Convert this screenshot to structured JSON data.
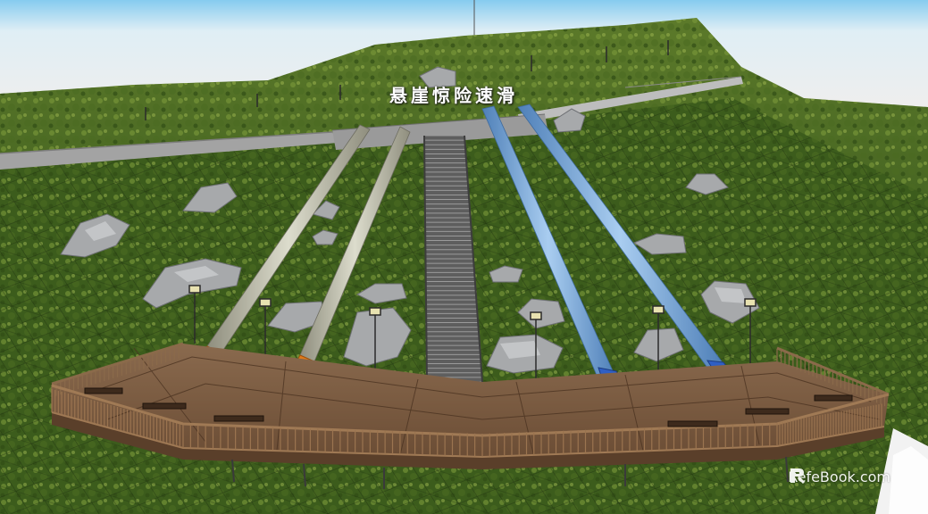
{
  "scene": {
    "sign_text": "悬崖惊险速滑",
    "watermark_text": "RefeBook.com",
    "watermark_icon": "relebook-logo-icon"
  },
  "colors": {
    "sky_top": "#8fd0f0",
    "sky_bottom": "#f5f5f5",
    "grass_dark": "#2f4a16",
    "grass_light": "#6f8f33",
    "slide_gray": "#b9b8a8",
    "slide_blue": "#7aa9d8",
    "slide_orange_end": "#e07a1a",
    "slide_blue_end": "#2f5fc4",
    "deck_wood": "#7a5a40",
    "railing": "#8a6a4a",
    "stairs": "#6b6b6b"
  }
}
